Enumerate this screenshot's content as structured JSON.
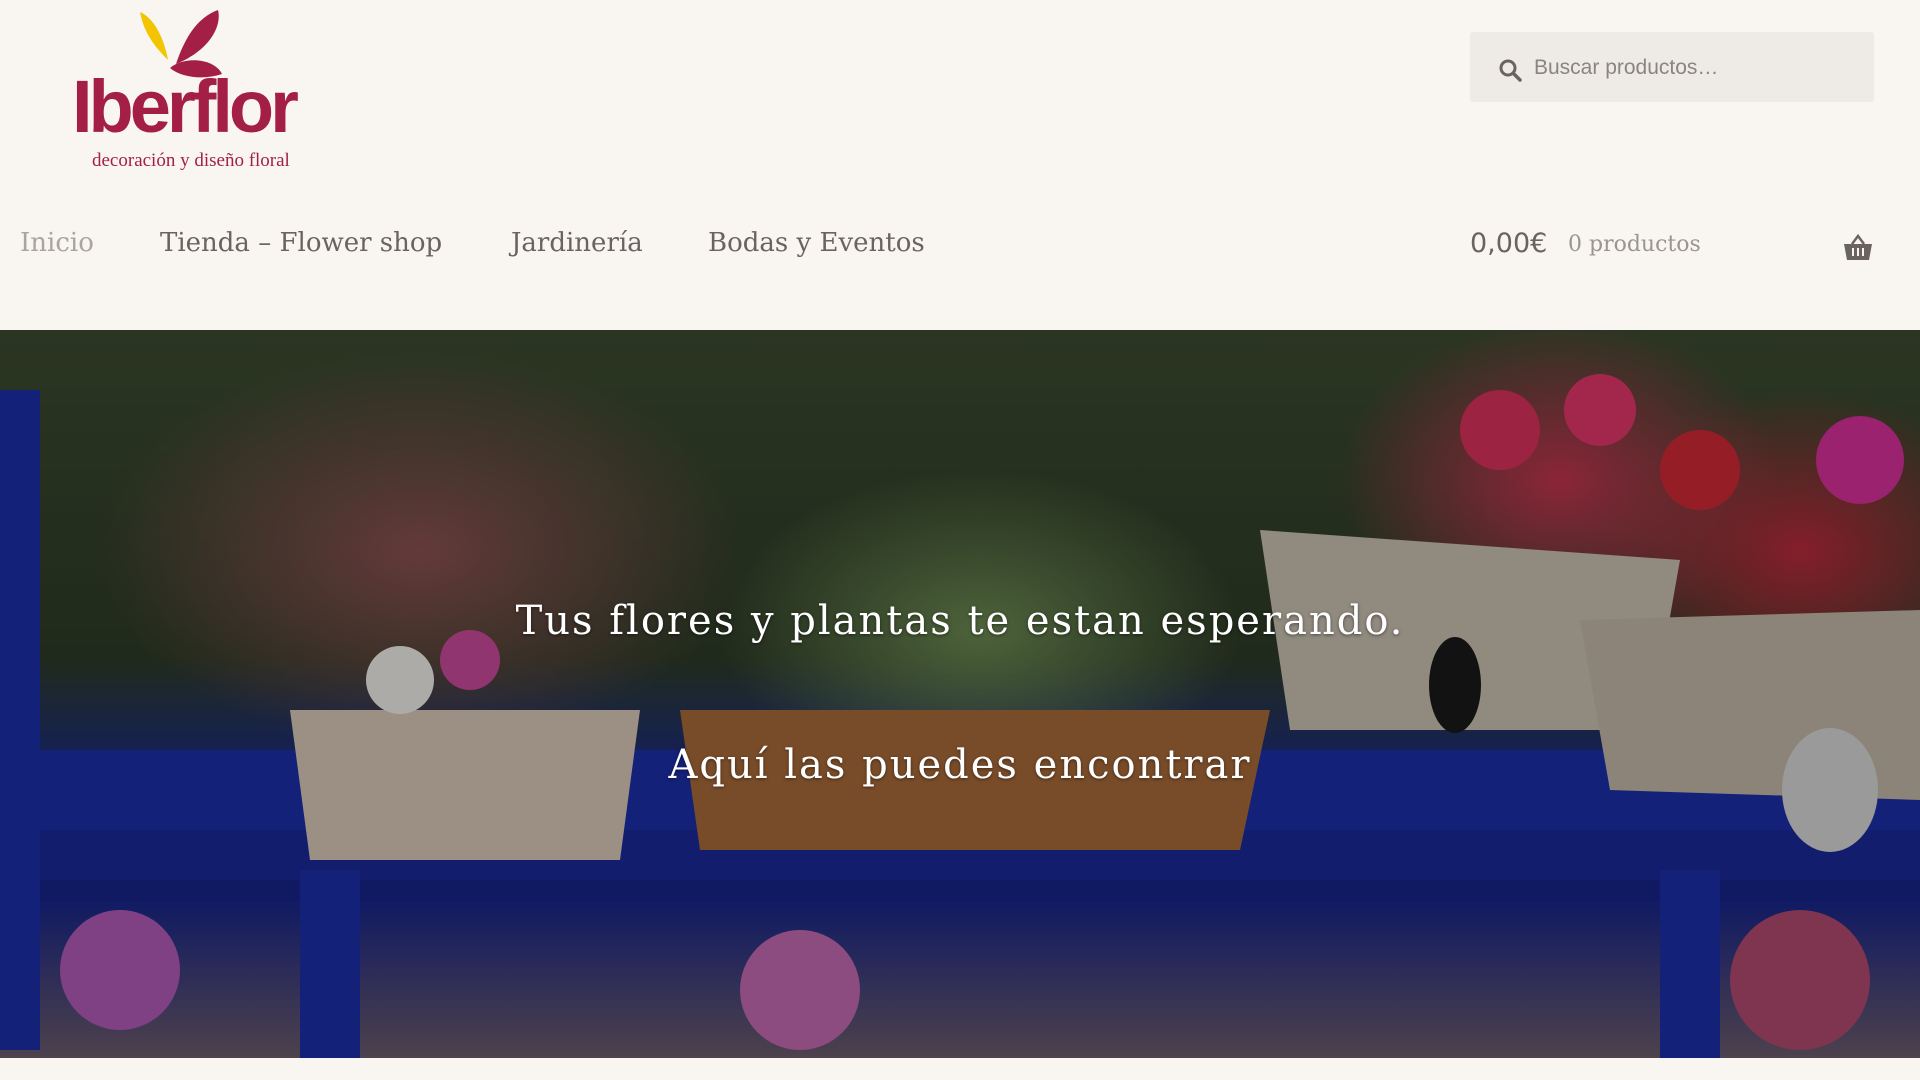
{
  "brand": {
    "name": "Iberflor",
    "tagline": "decoración y diseño floral",
    "colors": {
      "primary": "#a31f45",
      "accent": "#f2c500"
    }
  },
  "search": {
    "placeholder": "Buscar productos…",
    "value": "",
    "icon": "search-icon"
  },
  "nav": {
    "items": [
      {
        "label": "Inicio",
        "current": true
      },
      {
        "label": "Tienda – Flower shop"
      },
      {
        "label": "Jardinería"
      },
      {
        "label": "Bodas y Eventos"
      }
    ]
  },
  "cart": {
    "amount": "0,00€",
    "count": "0 productos",
    "icon": "basket-icon"
  },
  "hero": {
    "line1": "Tus flores y plantas te estan esperando.",
    "line2": "Aquí las puedes encontrar"
  }
}
